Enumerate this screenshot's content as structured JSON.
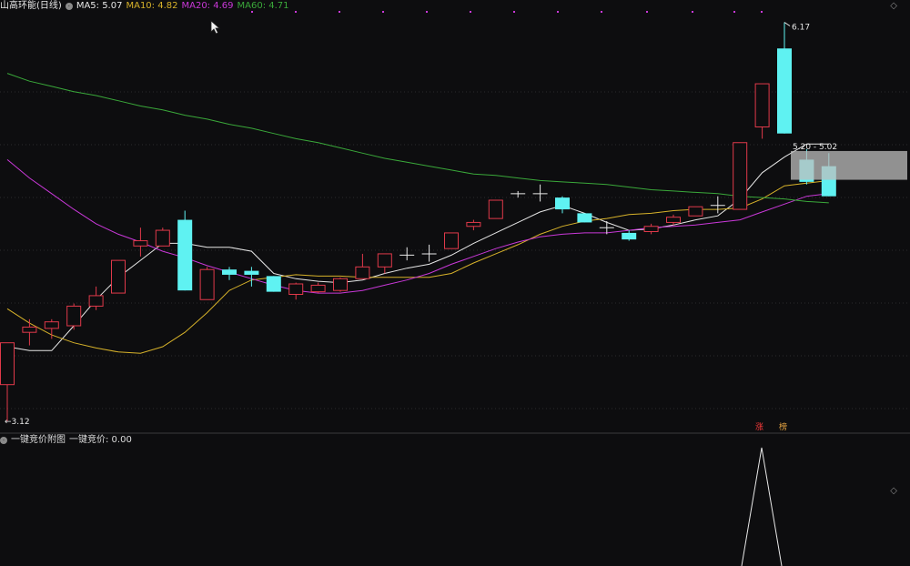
{
  "header": {
    "title": "山高环能(日线)",
    "ma5_label": "MA5: 5.07",
    "ma10_label": "MA10: 4.82",
    "ma20_label": "MA20: 4.69",
    "ma60_label": "MA60: 4.71"
  },
  "subchart": {
    "title": "一键竞价附图",
    "value_label": "一键竞价: 0.00",
    "tags": [
      "涨",
      "榜"
    ]
  },
  "annotations": {
    "high_label": "6.17",
    "low_label": "←3.12",
    "range_label": "5.20 - 5.02"
  },
  "colors": {
    "up": "#e0394a",
    "down": "#5ff2f2",
    "ma5": "#e6e6e6",
    "ma10": "#d7b22a",
    "ma20": "#c938d8",
    "ma60": "#3aa83a",
    "background": "#0d0d0f"
  },
  "chart_data": {
    "type": "candlestick",
    "ylim": [
      3.05,
      6.25
    ],
    "series": [
      {
        "name": "K",
        "values": [
          {
            "o": 3.4,
            "c": 3.72,
            "h": 3.72,
            "l": 3.12
          },
          {
            "o": 3.8,
            "c": 3.84,
            "h": 3.9,
            "l": 3.7
          },
          {
            "o": 3.83,
            "c": 3.88,
            "h": 3.9,
            "l": 3.75
          },
          {
            "o": 3.85,
            "c": 4.0,
            "h": 4.02,
            "l": 3.82
          },
          {
            "o": 4.0,
            "c": 4.08,
            "h": 4.15,
            "l": 3.97
          },
          {
            "o": 4.1,
            "c": 4.35,
            "h": 4.35,
            "l": 4.1
          },
          {
            "o": 4.46,
            "c": 4.5,
            "h": 4.6,
            "l": 4.38
          },
          {
            "o": 4.46,
            "c": 4.58,
            "h": 4.6,
            "l": 4.46
          },
          {
            "o": 4.66,
            "c": 4.12,
            "h": 4.73,
            "l": 4.12
          },
          {
            "o": 4.05,
            "c": 4.28,
            "h": 4.3,
            "l": 4.05
          },
          {
            "o": 4.28,
            "c": 4.24,
            "h": 4.3,
            "l": 4.2
          },
          {
            "o": 4.27,
            "c": 4.24,
            "h": 4.3,
            "l": 4.15
          },
          {
            "o": 4.23,
            "c": 4.11,
            "h": 4.23,
            "l": 4.11
          },
          {
            "o": 4.09,
            "c": 4.17,
            "h": 4.18,
            "l": 4.05
          },
          {
            "o": 4.11,
            "c": 4.16,
            "h": 4.18,
            "l": 4.1
          },
          {
            "o": 4.12,
            "c": 4.21,
            "h": 4.22,
            "l": 4.11
          },
          {
            "o": 4.21,
            "c": 4.3,
            "h": 4.4,
            "l": 4.21
          },
          {
            "o": 4.3,
            "c": 4.4,
            "h": 4.4,
            "l": 4.25
          },
          {
            "o": 4.39,
            "c": 4.39,
            "h": 4.45,
            "l": 4.35
          },
          {
            "o": 4.4,
            "c": 4.4,
            "h": 4.47,
            "l": 4.34
          },
          {
            "o": 4.44,
            "c": 4.56,
            "h": 4.56,
            "l": 4.44
          },
          {
            "o": 4.61,
            "c": 4.64,
            "h": 4.66,
            "l": 4.58
          },
          {
            "o": 4.67,
            "c": 4.81,
            "h": 4.81,
            "l": 4.67
          },
          {
            "o": 4.86,
            "c": 4.86,
            "h": 4.88,
            "l": 4.83
          },
          {
            "o": 4.86,
            "c": 4.86,
            "h": 4.93,
            "l": 4.8
          },
          {
            "o": 4.83,
            "c": 4.74,
            "h": 4.84,
            "l": 4.71
          },
          {
            "o": 4.71,
            "c": 4.64,
            "h": 4.71,
            "l": 4.64
          },
          {
            "o": 4.6,
            "c": 4.6,
            "h": 4.65,
            "l": 4.55
          },
          {
            "o": 4.56,
            "c": 4.51,
            "h": 4.58,
            "l": 4.5
          },
          {
            "o": 4.57,
            "c": 4.61,
            "h": 4.63,
            "l": 4.55
          },
          {
            "o": 4.64,
            "c": 4.68,
            "h": 4.7,
            "l": 4.62
          },
          {
            "o": 4.69,
            "c": 4.76,
            "h": 4.76,
            "l": 4.69
          },
          {
            "o": 4.77,
            "c": 4.77,
            "h": 4.84,
            "l": 4.71
          },
          {
            "o": 4.74,
            "c": 5.25,
            "h": 5.25,
            "l": 4.74
          },
          {
            "o": 5.37,
            "c": 5.7,
            "h": 5.7,
            "l": 5.28
          },
          {
            "o": 5.97,
            "c": 5.32,
            "h": 6.17,
            "l": 5.32
          },
          {
            "o": 5.12,
            "c": 4.95,
            "h": 5.2,
            "l": 4.93
          },
          {
            "o": 5.07,
            "c": 4.84,
            "h": 5.17,
            "l": 4.84
          }
        ]
      },
      {
        "name": "MA5",
        "values": [
          3.69,
          3.66,
          3.66,
          3.85,
          4.05,
          4.22,
          4.35,
          4.48,
          4.48,
          4.45,
          4.45,
          4.42,
          4.25,
          4.21,
          4.19,
          4.18,
          4.2,
          4.25,
          4.29,
          4.32,
          4.39,
          4.48,
          4.56,
          4.64,
          4.72,
          4.77,
          4.71,
          4.64,
          4.58,
          4.59,
          4.62,
          4.66,
          4.69,
          4.82,
          5.02,
          5.14,
          5.24,
          5.24
        ]
      },
      {
        "name": "MA10",
        "values": [
          3.98,
          3.87,
          3.78,
          3.72,
          3.68,
          3.65,
          3.64,
          3.69,
          3.8,
          3.95,
          4.12,
          4.2,
          4.22,
          4.24,
          4.23,
          4.23,
          4.22,
          4.22,
          4.22,
          4.22,
          4.25,
          4.33,
          4.4,
          4.47,
          4.55,
          4.61,
          4.65,
          4.67,
          4.7,
          4.71,
          4.73,
          4.74,
          4.74,
          4.75,
          4.82,
          4.92,
          4.94,
          4.96
        ]
      },
      {
        "name": "MA20",
        "values": [
          5.12,
          4.98,
          4.86,
          4.74,
          4.63,
          4.55,
          4.49,
          4.42,
          4.37,
          4.31,
          4.26,
          4.21,
          4.16,
          4.12,
          4.1,
          4.1,
          4.12,
          4.16,
          4.2,
          4.25,
          4.32,
          4.38,
          4.44,
          4.49,
          4.53,
          4.55,
          4.56,
          4.56,
          4.58,
          4.6,
          4.61,
          4.62,
          4.64,
          4.66,
          4.72,
          4.78,
          4.84,
          4.86
        ]
      },
      {
        "name": "MA60",
        "values": [
          5.78,
          5.72,
          5.68,
          5.64,
          5.61,
          5.57,
          5.53,
          5.5,
          5.46,
          5.43,
          5.39,
          5.36,
          5.32,
          5.28,
          5.25,
          5.21,
          5.17,
          5.13,
          5.1,
          5.07,
          5.04,
          5.01,
          5.0,
          4.98,
          4.96,
          4.95,
          4.94,
          4.93,
          4.91,
          4.89,
          4.88,
          4.87,
          4.86,
          4.84,
          4.83,
          4.82,
          4.8,
          4.79
        ]
      }
    ]
  }
}
